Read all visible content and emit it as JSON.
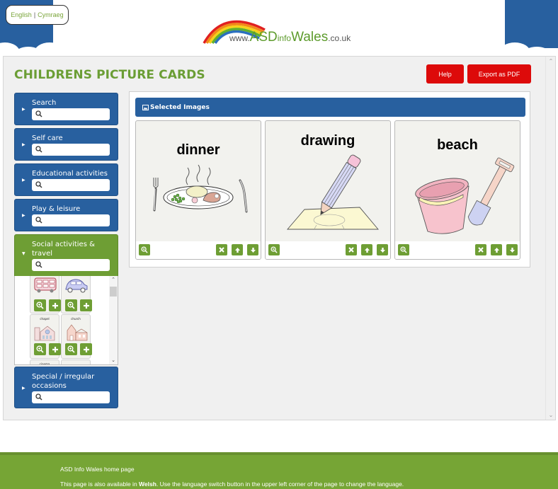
{
  "language_switch": {
    "english": "English",
    "separator": "|",
    "welsh": "Cymraeg"
  },
  "logo": {
    "prefix": "www.",
    "brand_main": "ASD",
    "brand_info": "info",
    "brand_wales": "Wales",
    "suffix": ".co.uk"
  },
  "page": {
    "title": "CHILDRENS PICTURE CARDS",
    "help_label": "Help",
    "export_label": "Export as PDF"
  },
  "sidebar": {
    "categories": [
      {
        "label": "Search",
        "expanded": false,
        "search_placeholder": ""
      },
      {
        "label": "Self care",
        "expanded": false,
        "search_placeholder": ""
      },
      {
        "label": "Educational activities",
        "expanded": false,
        "search_placeholder": ""
      },
      {
        "label": "Play & leisure",
        "expanded": false,
        "search_placeholder": ""
      },
      {
        "label": "Social activities & travel",
        "label_line1": "Social activities &",
        "label_line2": "travel",
        "expanded": true,
        "search_placeholder": ""
      },
      {
        "label": "Special / irregular occasions",
        "label_line1": "Special / irregular",
        "label_line2": "occasions",
        "expanded": false,
        "search_placeholder": ""
      }
    ],
    "open_tray": {
      "thumbnails": [
        {
          "name": "bus",
          "caption": ""
        },
        {
          "name": "car",
          "caption": ""
        },
        {
          "name": "chapel",
          "caption": "chapel"
        },
        {
          "name": "church",
          "caption": "church"
        },
        {
          "name": "cinema",
          "caption": "cinema"
        },
        {
          "name": "unknown",
          "caption": ""
        }
      ]
    }
  },
  "selected": {
    "header": "Selected Images",
    "icon": "image-icon",
    "cards": [
      {
        "word": "dinner",
        "image": "dinner-plate-illustration"
      },
      {
        "word": "drawing",
        "image": "pencil-drawing-illustration"
      },
      {
        "word": "beach",
        "image": "bucket-spade-illustration"
      }
    ]
  },
  "colors": {
    "brand_blue": "#28609f",
    "brand_green": "#6e9e34",
    "title_green": "#6b9e35",
    "button_red": "#dd0a0a",
    "footer_green": "#76a535"
  },
  "footer": {
    "home_link": "ASD Info Wales home page",
    "note_before": "This page is also available in ",
    "note_bold": "Welsh",
    "note_after": ". Use the language switch button in the upper left corner of the page to change the language."
  }
}
